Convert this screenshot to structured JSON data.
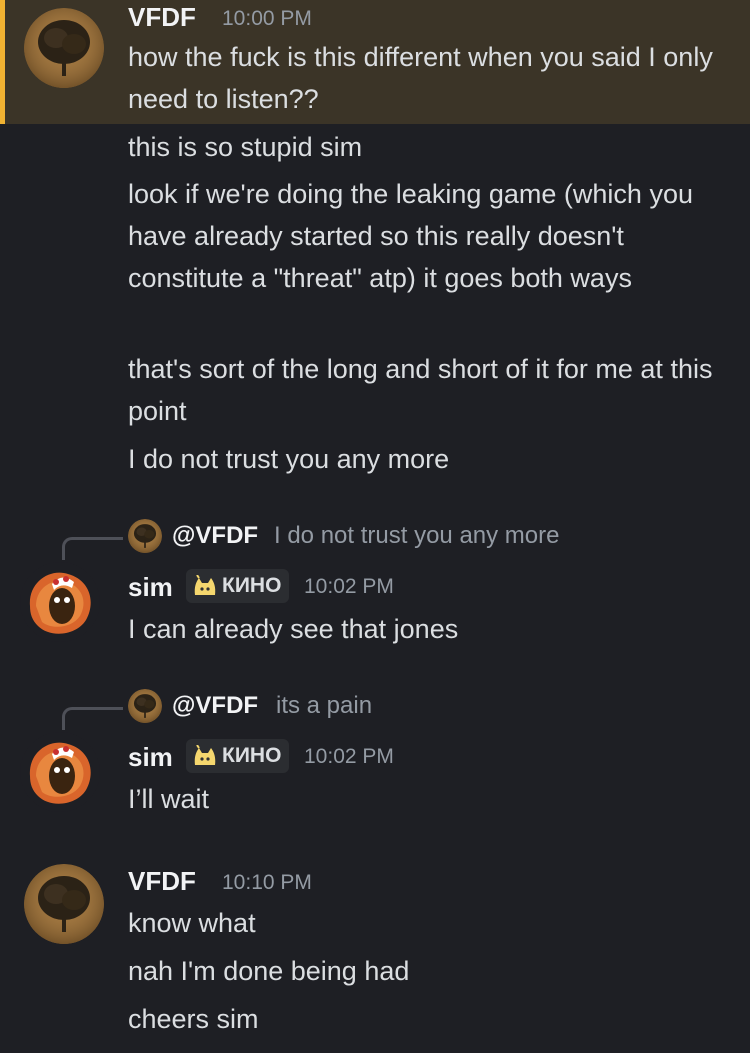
{
  "colors": {
    "background": "#1e1f24",
    "highlight_background": "#3b3427",
    "highlight_bar": "#f0b232",
    "text": "#dbdee1",
    "muted": "#949ba4",
    "author": "#f2f3f5"
  },
  "messages": [
    {
      "author": "VFDF",
      "time": "10:00 PM",
      "avatar_icon": "tree-avatar-icon",
      "lines": [
        "how the fuck is this different when you said I only need to listen??",
        "this is so stupid sim",
        "look if we're doing the leaking game (which you have already started so this really doesn't constitute a \"threat\" atp) it goes both ways",
        "that's sort of the long and short of it for me at this point",
        "I do not trust you any more"
      ]
    },
    {
      "reply": {
        "author": "@VFDF",
        "text": "I do not trust you any more"
      },
      "author": "sim",
      "tag": "КИНО",
      "tag_icon": "cat-emoji-icon",
      "time": "10:02 PM",
      "avatar_icon": "sim-avatar-icon",
      "lines": [
        "I can already see that jones"
      ]
    },
    {
      "reply": {
        "author": "@VFDF",
        "text": "its a pain"
      },
      "author": "sim",
      "tag": "КИНО",
      "tag_icon": "cat-emoji-icon",
      "time": "10:02 PM",
      "avatar_icon": "sim-avatar-icon",
      "lines": [
        "I’ll wait"
      ]
    },
    {
      "author": "VFDF",
      "time": "10:10 PM",
      "avatar_icon": "tree-avatar-icon",
      "lines": [
        "know what",
        "nah I'm done being had",
        "cheers sim"
      ]
    }
  ]
}
